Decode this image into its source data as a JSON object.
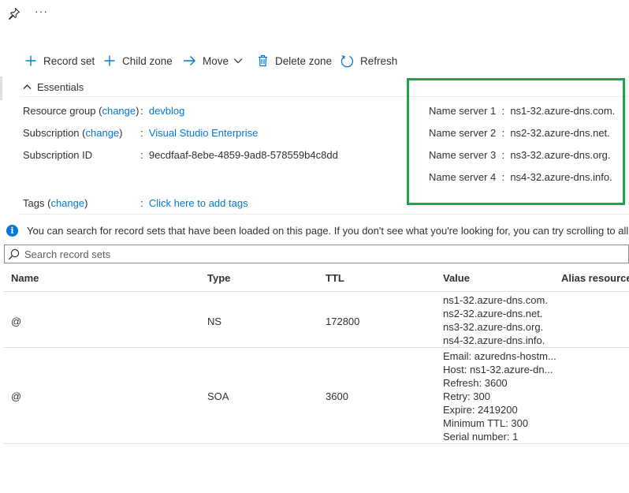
{
  "toolbar": {
    "record_set": "Record set",
    "child_zone": "Child zone",
    "move": "Move",
    "delete_zone": "Delete zone",
    "refresh": "Refresh"
  },
  "top": {
    "more": "···"
  },
  "essentials": {
    "title": "Essentials",
    "resource_group_key": "Resource group",
    "change": "change",
    "resource_group_value": "devblog",
    "subscription_key": "Subscription",
    "subscription_value": "Visual Studio Enterprise",
    "subscription_id_key": "Subscription ID",
    "subscription_id_value": "9ecdfaaf-8ebe-4859-9ad8-578559b4c8dd",
    "tags_key": "Tags",
    "tags_value": "Click here to add tags",
    "name_servers": [
      {
        "key": "Name server 1",
        "value": "ns1-32.azure-dns.com."
      },
      {
        "key": "Name server 2",
        "value": "ns2-32.azure-dns.net."
      },
      {
        "key": "Name server 3",
        "value": "ns3-32.azure-dns.org."
      },
      {
        "key": "Name server 4",
        "value": "ns4-32.azure-dns.info."
      }
    ],
    "highlight_color": "#21a34d"
  },
  "info": {
    "text": "You can search for record sets that have been loaded on this page. If you don't see what you're looking for, you can try scrolling to all"
  },
  "search": {
    "placeholder": "Search record sets"
  },
  "table": {
    "columns": [
      "Name",
      "Type",
      "TTL",
      "Value",
      "Alias resource"
    ],
    "rows": [
      {
        "name": "@",
        "type": "NS",
        "ttl": "172800",
        "value": [
          "ns1-32.azure-dns.com.",
          "ns2-32.azure-dns.net.",
          "ns3-32.azure-dns.org.",
          "ns4-32.azure-dns.info."
        ]
      },
      {
        "name": "@",
        "type": "SOA",
        "ttl": "3600",
        "value": [
          "Email: azuredns-hostm...",
          "Host: ns1-32.azure-dn...",
          "Refresh: 3600",
          "Retry: 300",
          "Expire: 2419200",
          "Minimum TTL: 300",
          "Serial number: 1"
        ]
      }
    ]
  },
  "colors": {
    "accent": "#0078d4",
    "text": "#323130"
  }
}
